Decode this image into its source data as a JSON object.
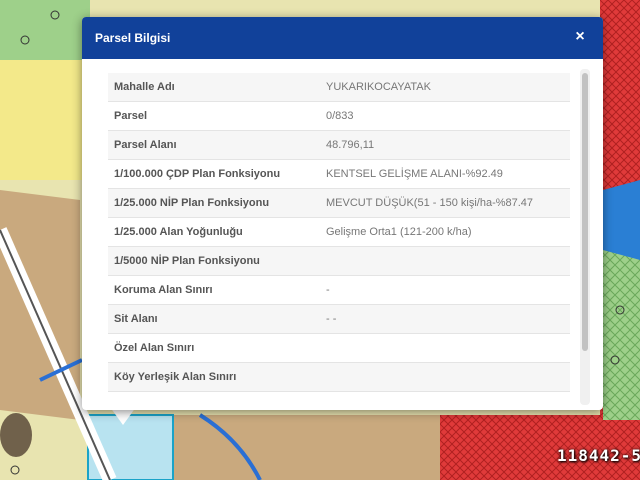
{
  "popup": {
    "title": "Parsel Bilgisi",
    "close_label": "×"
  },
  "rows": [
    {
      "key": "Mahalle Adı",
      "value": "YUKARIKOCAYATAK"
    },
    {
      "key": "Parsel",
      "value": "0/833"
    },
    {
      "key": "Parsel Alanı",
      "value": "48.796,11"
    },
    {
      "key": "1/100.000 ÇDP Plan Fonksiyonu",
      "value": "KENTSEL GELİŞME ALANI-%92.49"
    },
    {
      "key": "1/25.000 NİP Plan Fonksiyonu",
      "value": "MEVCUT DÜŞÜK(51 - 150 kişi/ha-%87.47"
    },
    {
      "key": "1/25.000 Alan Yoğunluğu",
      "value": "Gelişme Orta1 (121-200 k/ha)"
    },
    {
      "key": "1/5000 NİP Plan Fonksiyonu",
      "value": ""
    },
    {
      "key": "Koruma Alan Sınırı",
      "value": " -"
    },
    {
      "key": "Sit Alanı",
      "value": " -  -"
    },
    {
      "key": "Özel Alan Sınırı",
      "value": ""
    },
    {
      "key": "Köy Yerleşik Alan Sınırı",
      "value": ""
    }
  ],
  "watermark": "118442-5",
  "colors": {
    "header": "#11419a",
    "map_yellow": "#e8e4b0",
    "map_brown": "#c9a97e",
    "map_red": "#e03a3a",
    "map_green": "#7fbf6a"
  }
}
